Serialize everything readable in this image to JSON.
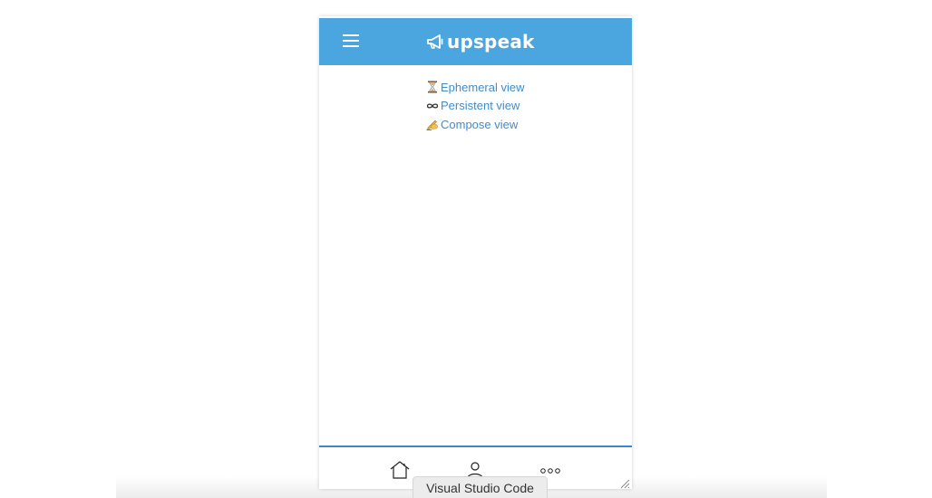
{
  "header": {
    "brand_name": "upspeak",
    "background_color": "#4ba5de",
    "menu_icon": "hamburger-menu-icon",
    "brand_icon": "megaphone-icon"
  },
  "views": [
    {
      "icon": "hourglass-icon",
      "label": "Ephemeral view"
    },
    {
      "icon": "infinity-icon",
      "label": "Persistent view"
    },
    {
      "icon": "writing-hand-icon",
      "label": "Compose view"
    }
  ],
  "link_color": "#3f8ccd",
  "bottom_nav": {
    "border_color": "#3d87c9",
    "items": [
      {
        "icon": "home-icon"
      },
      {
        "icon": "user-icon"
      },
      {
        "icon": "more-dots-icon"
      }
    ]
  },
  "tooltip": {
    "text": "Visual Studio Code"
  }
}
